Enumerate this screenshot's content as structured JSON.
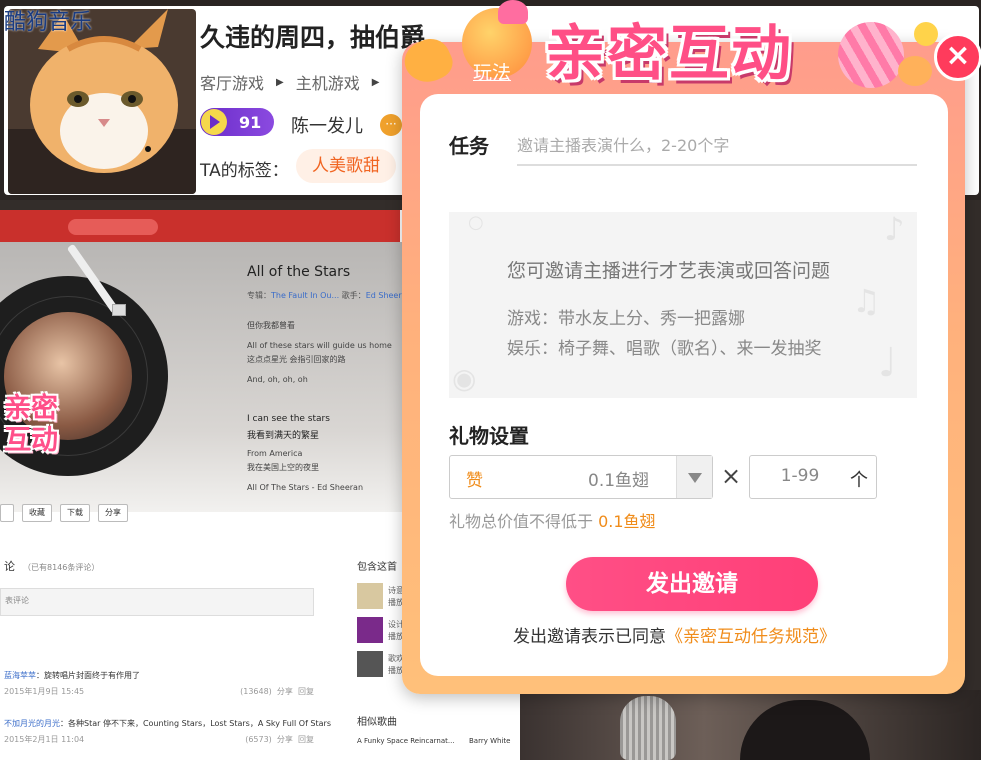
{
  "header": {
    "title": "久违的周四，抽伯爵",
    "categories": [
      "客厅游戏",
      "主机游戏"
    ],
    "level": "91",
    "host_name": "陈一发儿",
    "tag_label": "TA的标签：",
    "tag": "人美歌甜"
  },
  "stream": {
    "app_label": "酷狗音乐",
    "intimacy_logo": [
      "亲密",
      "互动"
    ],
    "song": {
      "title": "All of the Stars",
      "album_label": "专辑：",
      "album": "The Fault In Ou...",
      "singer_label": "歌手：",
      "singer": "Ed Sheeran"
    },
    "lyrics": [
      "但你我都曾看",
      "All of these stars will guide us home",
      "这点点星光 会指引回家的路",
      "And, oh, oh, oh",
      "I can see the stars",
      "我看到满天的繁星",
      "From America",
      "我在美国上空的夜里",
      "All Of The Stars - Ed Sheeran"
    ],
    "buttons": [
      "收藏",
      "下载",
      "分享"
    ],
    "comments_title": "论",
    "comments_count": "（已有8146条评论）",
    "comment_placeholder": "表评论",
    "comments": [
      {
        "user": "蓝海苹苹",
        "text": "：旋转唱片封面终于有作用了",
        "date": "2015年1月9日 15:45",
        "likes": "(13648)",
        "share": "分享",
        "reply": "回复"
      },
      {
        "user": "不加月光的月光",
        "text": "：各种Star 停不下来，Counting Stars，Lost Stars，A Sky Full Of Stars",
        "date": "2015年2月1日 11:04",
        "likes": "(6573)",
        "share": "分享",
        "reply": "回复"
      }
    ],
    "side_title": "包含这首",
    "side_items": [
      "诗意",
      "设计",
      "歌欢"
    ],
    "side_sub": "播放",
    "similar_title": "相似歌曲",
    "similar_row": {
      "song": "A Funky Space Reincarnat...",
      "artist": "Barry White"
    }
  },
  "modal": {
    "rules_link": "玩法",
    "banner": "亲密互动",
    "close": "×",
    "task_label": "任务",
    "task_placeholder": "邀请主播表演什么，2-20个字",
    "hint_title": "您可邀请主播进行才艺表演或回答问题",
    "hint_lines": [
      "游戏：带水友上分、秀一把露娜",
      "娱乐：椅子舞、唱歌（歌名）、来一发抽奖"
    ],
    "gift_label": "礼物设置",
    "gift_name": "赞",
    "gift_price": "0.1鱼翅",
    "times": "×",
    "qty_placeholder": "1-99",
    "qty_unit": "个",
    "min_note_prefix": "礼物总价值不得低于",
    "min_note_value": "0.1鱼翅",
    "send_button": "发出邀请",
    "agree_prefix": "发出邀请表示已同意",
    "agree_link": "《亲密互动任务规范》"
  },
  "colors": {
    "accent_pink": "#ff4f86",
    "accent_orange": "#f08c1a",
    "tag_orange": "#f16522",
    "level_purple": "#6a2cc9"
  }
}
